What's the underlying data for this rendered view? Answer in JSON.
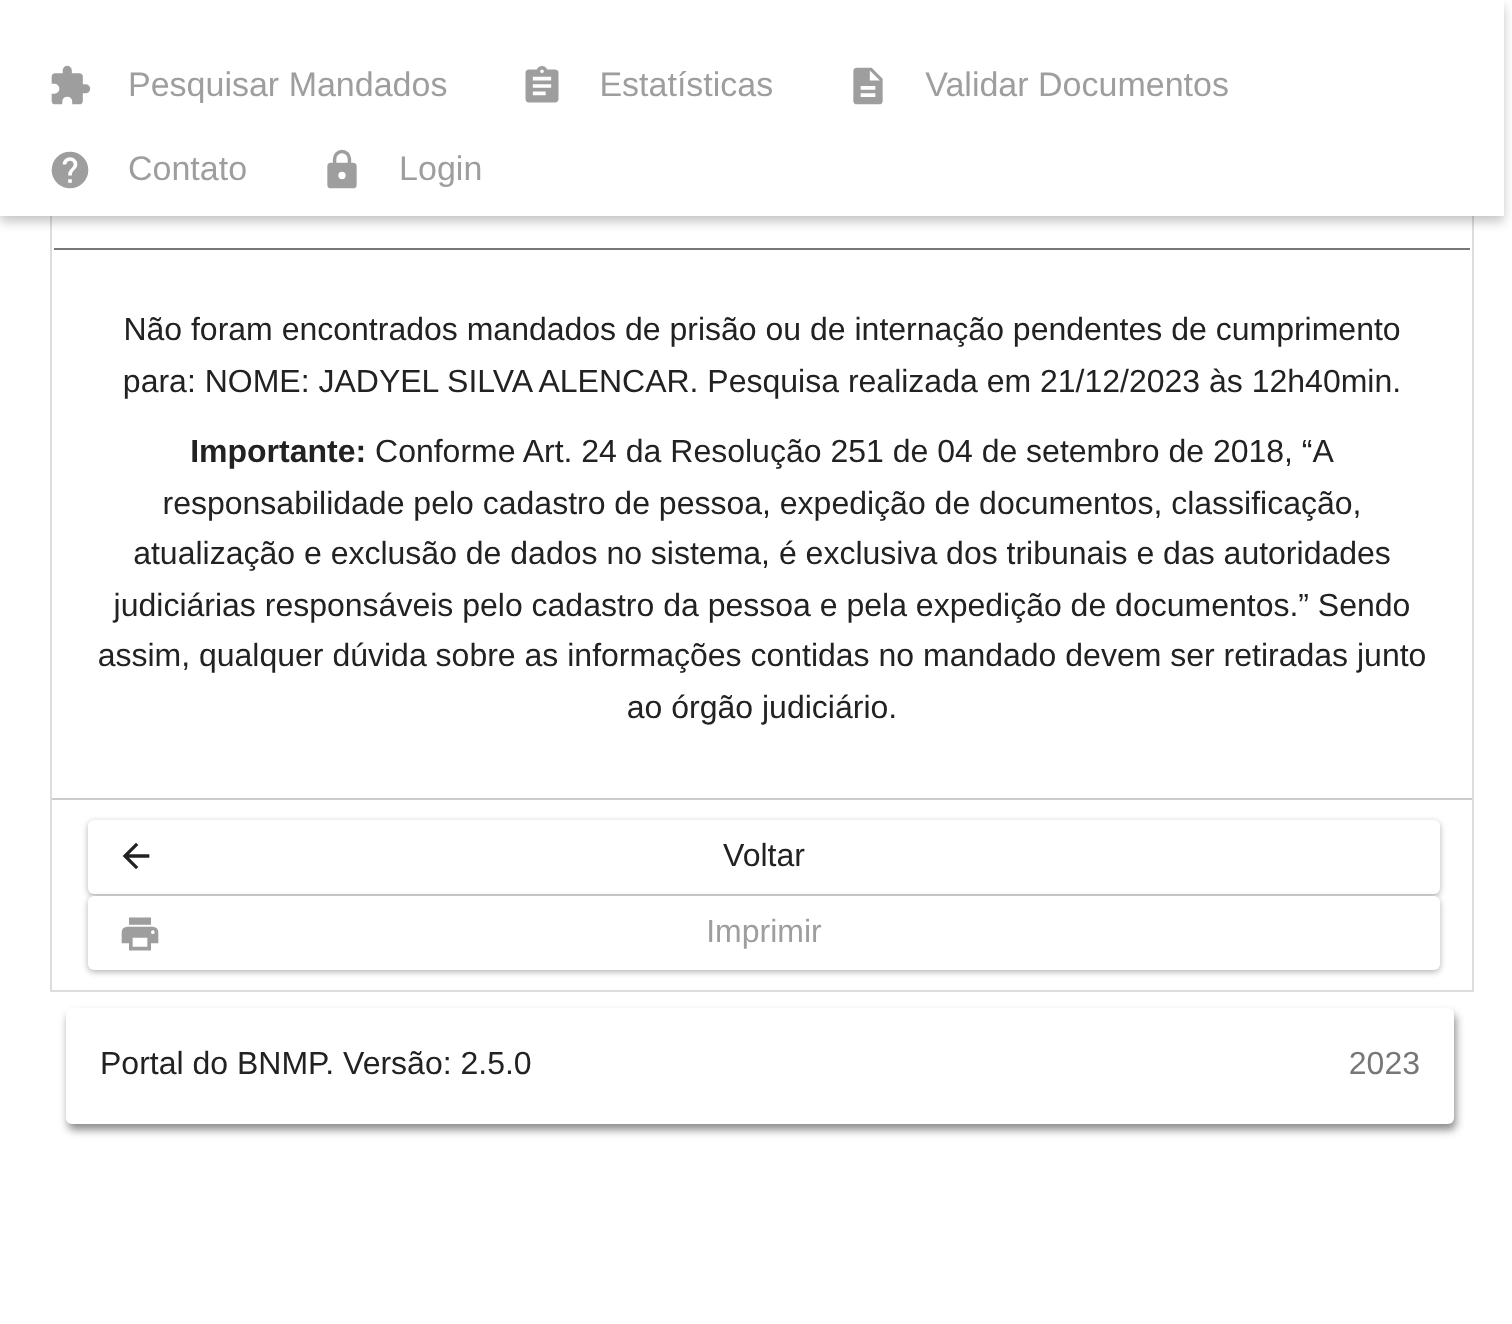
{
  "nav": {
    "items": [
      {
        "label": "Pesquisar Mandados"
      },
      {
        "label": "Estatísticas"
      },
      {
        "label": "Validar Documentos"
      },
      {
        "label": "Contato"
      },
      {
        "label": "Login"
      }
    ]
  },
  "result": {
    "message": "Não foram encontrados mandados de prisão ou de internação pendentes de cumprimento para: NOME: JADYEL SILVA ALENCAR. Pesquisa realizada em 21/12/2023 às 12h40min.",
    "notice": "**Importante:** Conforme Art. 24 da Resolução 251 de 04 de setembro de 2018, “A responsabilidade pelo cadastro de pessoa, expedição de documentos, classificação, atualização e exclusão de dados no sistema, é exclusiva dos tribunais e das autoridades judiciárias responsáveis pelo cadastro da pessoa e pela expedição de documentos.” Sendo assim, qualquer dúvida sobre as informações contidas no mandado devem ser retiradas junto ao órgão judiciário.",
    "buttons": [
      {
        "label": "Voltar",
        "disabled": false
      },
      {
        "label": "Imprimir",
        "disabled": true
      }
    ]
  },
  "footer": {
    "version": "Portal do BNMP. Versão: 2.5.0",
    "year": "2023"
  }
}
